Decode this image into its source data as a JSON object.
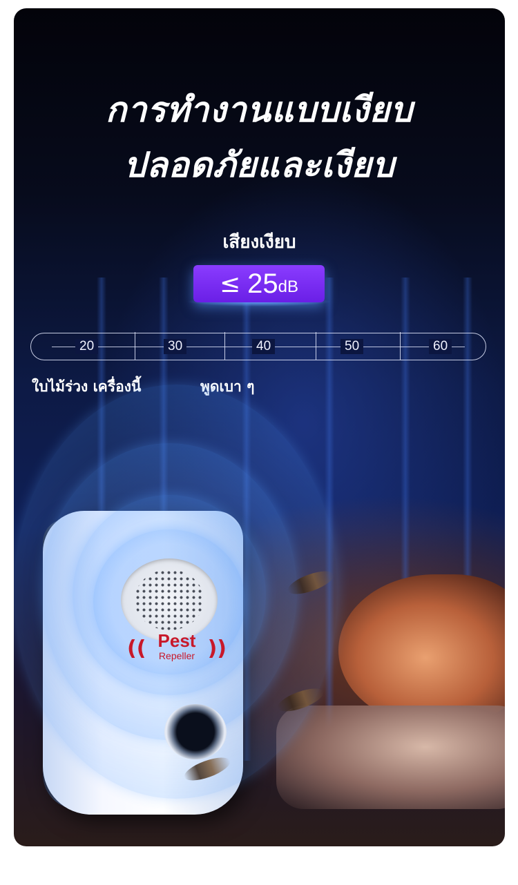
{
  "headline": {
    "line1": "การทำงานแบบเงียบ",
    "line2": "ปลอดภัยและเงียบ"
  },
  "noise": {
    "label": "เสียงเงียบ",
    "symbol": "≤",
    "value": "25",
    "unit": "dB"
  },
  "scale": {
    "ticks": [
      "20",
      "30",
      "40",
      "50",
      "60"
    ],
    "captions": {
      "left": "ใบไม้ร่วง เครื่องนี้",
      "right": "พูดเบา ๆ"
    }
  },
  "product": {
    "logo_title": "Pest",
    "logo_sub": "Repeller"
  },
  "colors": {
    "badge": "#7a2ef5",
    "logo_red": "#c8182a",
    "wave_blue": "#4f8fff"
  }
}
